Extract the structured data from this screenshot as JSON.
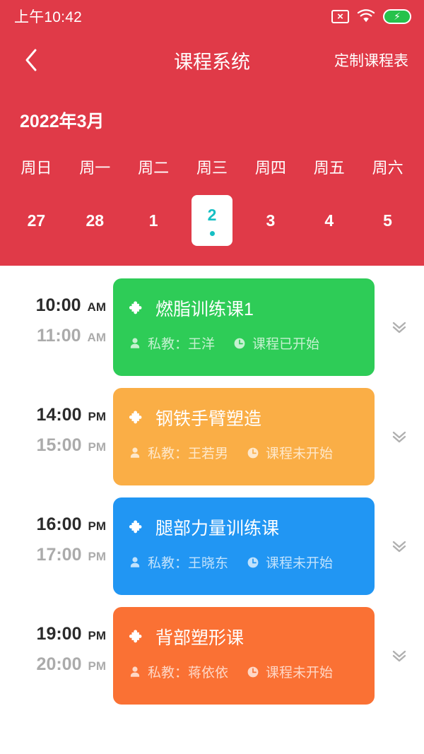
{
  "status_bar": {
    "time": "上午10:42",
    "icons": [
      "sim-off-icon",
      "wifi-icon",
      "battery-charging-icon"
    ]
  },
  "header": {
    "back_icon": "chevron-left-icon",
    "title": "课程系统",
    "action_label": "定制课程表",
    "month_label": "2022年3月",
    "accent_color": "#E03A48",
    "selected_color": "#16BFC4"
  },
  "calendar": {
    "weekdays": [
      "周日",
      "周一",
      "周二",
      "周三",
      "周四",
      "周五",
      "周六"
    ],
    "dates": [
      {
        "day": "27",
        "selected": false,
        "has_dot": false
      },
      {
        "day": "28",
        "selected": false,
        "has_dot": false
      },
      {
        "day": "1",
        "selected": false,
        "has_dot": false
      },
      {
        "day": "2",
        "selected": true,
        "has_dot": true
      },
      {
        "day": "3",
        "selected": false,
        "has_dot": false
      },
      {
        "day": "4",
        "selected": false,
        "has_dot": false
      },
      {
        "day": "5",
        "selected": false,
        "has_dot": false
      }
    ]
  },
  "schedule": [
    {
      "start_time": "10:00",
      "start_meridiem": "AM",
      "end_time": "11:00",
      "end_meridiem": "AM",
      "title": "燃脂训练课1",
      "coach": "私教：王洋",
      "status": "课程已开始",
      "color": "#2ECC57",
      "title_icon": "puzzle-icon",
      "coach_icon": "person-icon",
      "status_icon": "clock-icon",
      "expand_icon": "double-chevron-down-icon"
    },
    {
      "start_time": "14:00",
      "start_meridiem": "PM",
      "end_time": "15:00",
      "end_meridiem": "PM",
      "title": "钢铁手臂塑造",
      "coach": "私教：王若男",
      "status": "课程未开始",
      "color": "#FAAE46",
      "title_icon": "puzzle-icon",
      "coach_icon": "person-icon",
      "status_icon": "clock-icon",
      "expand_icon": "double-chevron-down-icon"
    },
    {
      "start_time": "16:00",
      "start_meridiem": "PM",
      "end_time": "17:00",
      "end_meridiem": "PM",
      "title": "腿部力量训练课",
      "coach": "私教：王晓东",
      "status": "课程未开始",
      "color": "#2196F3",
      "title_icon": "puzzle-icon",
      "coach_icon": "person-icon",
      "status_icon": "clock-icon",
      "expand_icon": "double-chevron-down-icon"
    },
    {
      "start_time": "19:00",
      "start_meridiem": "PM",
      "end_time": "20:00",
      "end_meridiem": "PM",
      "title": "背部塑形课",
      "coach": "私教：蒋依依",
      "status": "课程未开始",
      "color": "#FA7134",
      "title_icon": "puzzle-icon",
      "coach_icon": "person-icon",
      "status_icon": "clock-icon",
      "expand_icon": "double-chevron-down-icon"
    }
  ]
}
